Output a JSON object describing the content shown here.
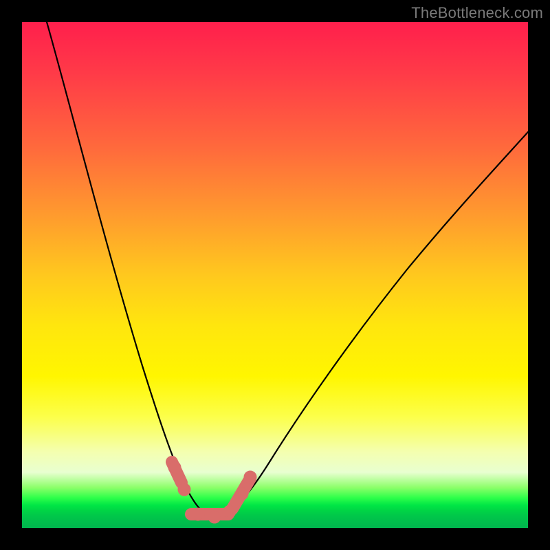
{
  "watermark": "TheBottleneck.com",
  "colors": {
    "frame": "#000000",
    "curve": "#000000",
    "marker": "#d96d6a"
  },
  "chart_data": {
    "type": "line",
    "title": "",
    "xlabel": "",
    "ylabel": "",
    "xlim": [
      0,
      100
    ],
    "ylim": [
      0,
      100
    ],
    "grid": false,
    "legend": false,
    "background_gradient": [
      "#ff1f4c",
      "#ffe60e",
      "#00b54e"
    ],
    "series": [
      {
        "name": "bottleneck-curve",
        "x": [
          5,
          8,
          12,
          16,
          20,
          24,
          27,
          29,
          31,
          33,
          35,
          37,
          39,
          41,
          44,
          48,
          54,
          60,
          68,
          76,
          84,
          92,
          100
        ],
        "y": [
          100,
          92,
          80,
          66,
          52,
          37,
          24,
          16,
          9,
          5,
          3,
          2,
          3,
          5,
          9,
          16,
          26,
          36,
          47,
          57,
          66,
          75,
          83
        ]
      }
    ],
    "marker_band": {
      "name": "valley-band",
      "x_range": [
        29,
        43
      ],
      "y_level": 3
    }
  }
}
